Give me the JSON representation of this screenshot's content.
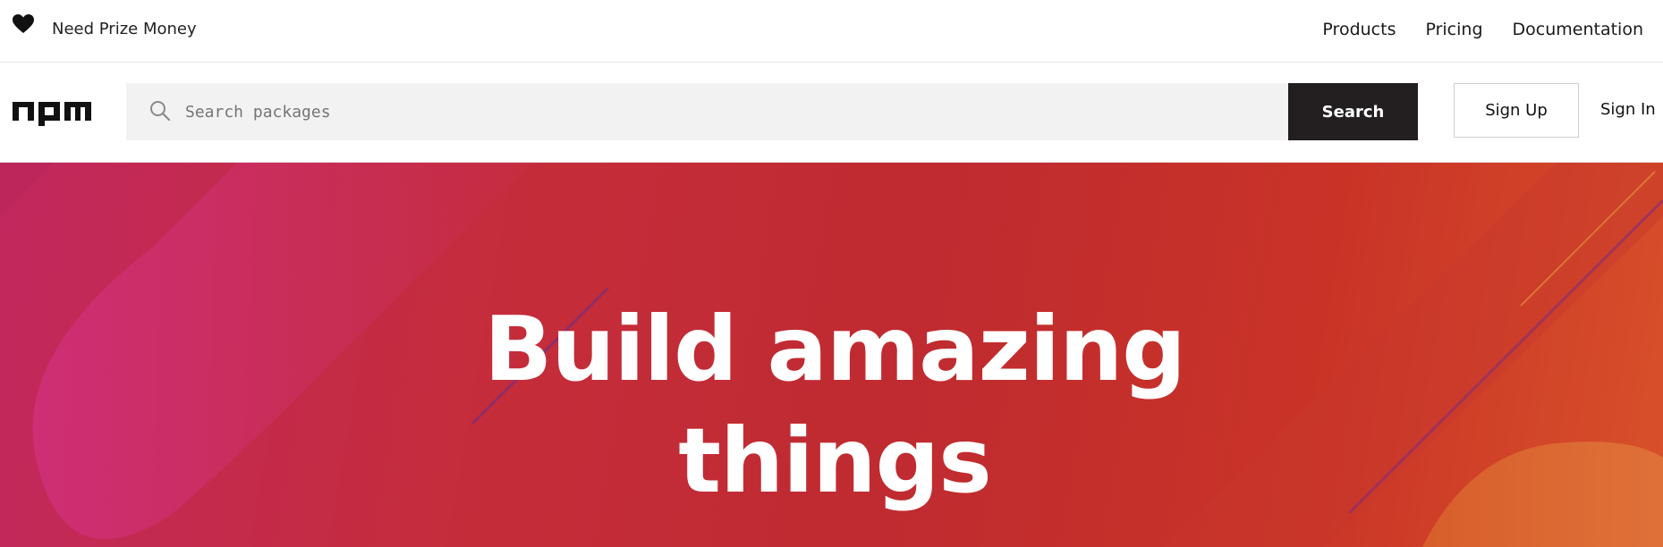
{
  "banner": {
    "icon": "heart-icon",
    "tagline": "Need Prize Money"
  },
  "top_nav": {
    "items": [
      {
        "label": "Products"
      },
      {
        "label": "Pricing"
      },
      {
        "label": "Documentation"
      }
    ]
  },
  "header": {
    "logo": "npm",
    "search": {
      "placeholder": "Search packages",
      "value": "",
      "icon": "search-icon",
      "button_label": "Search"
    },
    "signup_label": "Sign Up",
    "signin_label": "Sign In"
  },
  "hero": {
    "title_line1": "Build amazing",
    "title_line2": "things"
  },
  "colors": {
    "search_button_bg": "#231f20",
    "hero_pink": "#c2285e",
    "hero_red": "#bf2b30",
    "hero_orange": "#d8512a"
  }
}
